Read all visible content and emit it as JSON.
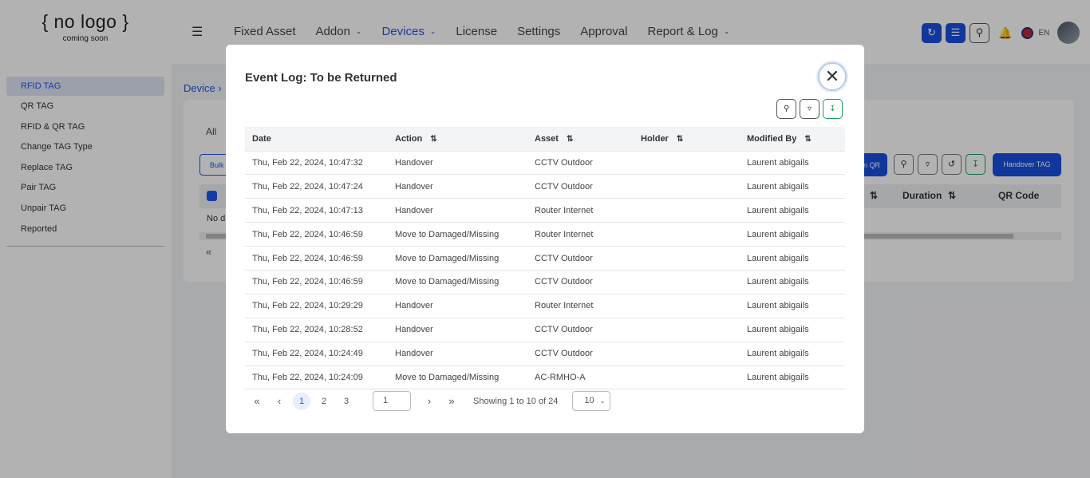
{
  "app": {
    "logo_line1": "{ no logo }",
    "logo_line2": "coming soon",
    "nav": [
      {
        "label": "Fixed Asset"
      },
      {
        "label": "Addon"
      },
      {
        "label": "Devices"
      },
      {
        "label": "License"
      },
      {
        "label": "Settings"
      },
      {
        "label": "Approval"
      },
      {
        "label": "Report & Log"
      }
    ],
    "language": "EN"
  },
  "sidebar": {
    "items": [
      {
        "label": "RFID TAG"
      },
      {
        "label": "QR TAG"
      },
      {
        "label": "RFID & QR TAG"
      },
      {
        "label": "Change TAG Type"
      },
      {
        "label": "Replace TAG"
      },
      {
        "label": "Pair TAG"
      },
      {
        "label": "Unpair TAG"
      },
      {
        "label": "Reported"
      }
    ]
  },
  "background": {
    "breadcrumb": "Device  ›",
    "tab_all": "All",
    "bulk_label": "Bulk",
    "no_data": "No d",
    "qr_button": "n QR",
    "handover_button": "Handover TAG",
    "col_duration": "Duration",
    "col_qr_code": "QR Code"
  },
  "modal": {
    "title": "Event Log: To be Returned",
    "columns": [
      "Date",
      "Action",
      "Asset",
      "Holder",
      "Modified By"
    ],
    "rows": [
      {
        "date": "Thu, Feb 22, 2024, 10:47:32",
        "action": "Handover",
        "asset": "CCTV Outdoor",
        "holder": "",
        "modified_by": "Laurent abigails"
      },
      {
        "date": "Thu, Feb 22, 2024, 10:47:24",
        "action": "Handover",
        "asset": "CCTV Outdoor",
        "holder": "",
        "modified_by": "Laurent abigails"
      },
      {
        "date": "Thu, Feb 22, 2024, 10:47:13",
        "action": "Handover",
        "asset": "Router Internet",
        "holder": "",
        "modified_by": "Laurent abigails"
      },
      {
        "date": "Thu, Feb 22, 2024, 10:46:59",
        "action": "Move to Damaged/Missing",
        "asset": "Router Internet",
        "holder": "",
        "modified_by": "Laurent abigails"
      },
      {
        "date": "Thu, Feb 22, 2024, 10:46:59",
        "action": "Move to Damaged/Missing",
        "asset": "CCTV Outdoor",
        "holder": "",
        "modified_by": "Laurent abigails"
      },
      {
        "date": "Thu, Feb 22, 2024, 10:46:59",
        "action": "Move to Damaged/Missing",
        "asset": "CCTV Outdoor",
        "holder": "",
        "modified_by": "Laurent abigails"
      },
      {
        "date": "Thu, Feb 22, 2024, 10:29:29",
        "action": "Handover",
        "asset": "Router Internet",
        "holder": "",
        "modified_by": "Laurent abigails"
      },
      {
        "date": "Thu, Feb 22, 2024, 10:28:52",
        "action": "Handover",
        "asset": "CCTV Outdoor",
        "holder": "",
        "modified_by": "Laurent abigails"
      },
      {
        "date": "Thu, Feb 22, 2024, 10:24:49",
        "action": "Handover",
        "asset": "CCTV Outdoor",
        "holder": "",
        "modified_by": "Laurent abigails"
      },
      {
        "date": "Thu, Feb 22, 2024, 10:24:09",
        "action": "Move to Damaged/Missing",
        "asset": "AC-RMHO-A",
        "holder": "",
        "modified_by": "Laurent abigails"
      }
    ],
    "pagination": {
      "pages": [
        "1",
        "2",
        "3"
      ],
      "current_page": "1",
      "page_input": "1",
      "info": "Showing 1 to 10 of 24",
      "page_size": "10"
    }
  },
  "colors": {
    "accent": "#1f56e8",
    "export_green": "#19a058",
    "notification_red": "#e54848"
  }
}
